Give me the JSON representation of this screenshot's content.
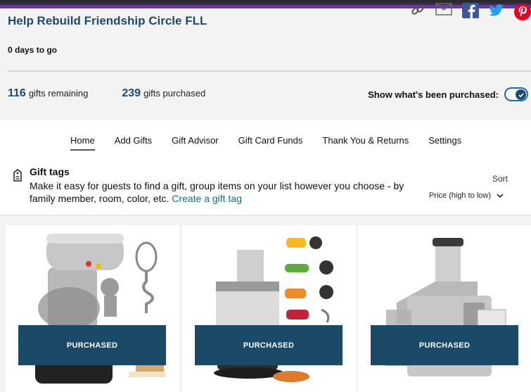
{
  "registry": {
    "title": "Help Rebuild Friendship Circle FLL",
    "countdown": "0 days to go"
  },
  "share_icons": [
    "link-icon",
    "mail-icon",
    "facebook-icon",
    "twitter-icon",
    "pinterest-icon"
  ],
  "stats": {
    "remaining_count": "116",
    "remaining_label": "gifts remaining",
    "purchased_count": "239",
    "purchased_label": "gifts purchased"
  },
  "toggle": {
    "label": "Show what's been purchased:",
    "on": true
  },
  "tabs": [
    {
      "label": "Home",
      "active": true
    },
    {
      "label": "Add Gifts"
    },
    {
      "label": "Gift Advisor"
    },
    {
      "label": "Gift Card Funds"
    },
    {
      "label": "Thank You & Returns"
    },
    {
      "label": "Settings"
    }
  ],
  "gift_tags": {
    "title": "Gift tags",
    "description": "Make it easy for guests to find a gift, group items on your list however you choose - by family member, room, color, etc.",
    "link": "Create a gift tag"
  },
  "sort": {
    "label": "Sort",
    "selected": "Price (high to low)"
  },
  "products": [
    {
      "badge": "PURCHASED",
      "image": "stand-mixer"
    },
    {
      "badge": "PURCHASED",
      "image": "food-processor"
    },
    {
      "badge": "PURCHASED",
      "image": "juicer"
    }
  ],
  "colors": {
    "brand_blue": "#1f4a6e",
    "badge_blue": "#1b4a69",
    "link": "#1a6e8a"
  }
}
